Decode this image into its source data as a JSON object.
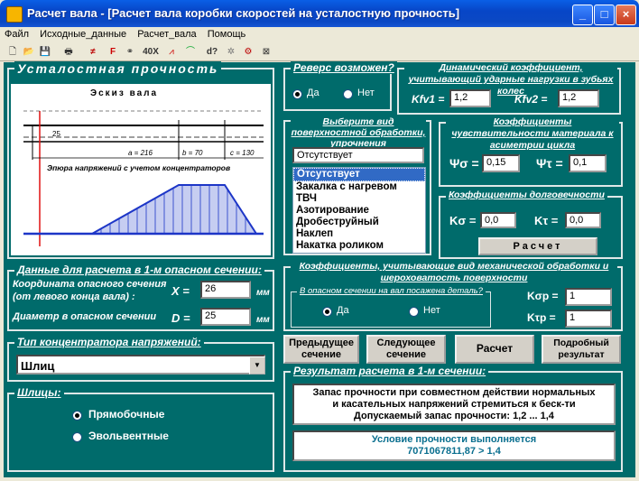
{
  "window": {
    "title": "Расчет вала - [Расчет вала коробки скоростей на усталостную прочность]"
  },
  "menu": [
    "Файл",
    "Исходные_данные",
    "Расчет_вала",
    "Помощь"
  ],
  "toolbar_icons": [
    "new-file-icon",
    "open-folder-icon",
    "save-icon",
    "print-icon",
    "formula-icon",
    "force-icon",
    "link-icon",
    "material-icon",
    "chart-icon",
    "bending-icon",
    "help-icon",
    "gear-icon",
    "settings-icon",
    "close-icon"
  ],
  "toolbar_text": {
    "material": "40Х",
    "help": "d?",
    "force": "F"
  },
  "fatigue": {
    "title": "Усталостная прочность",
    "sketch_title": "Эскиз вала",
    "dim_25": "25",
    "dim_a": "a = 216",
    "dim_b": "b = 70",
    "dim_c": "c = 130",
    "diagram_title": "Эпюра напряжений с учетом концентраторов"
  },
  "reverse": {
    "title": "Реверс возможен?",
    "yes": "Да",
    "no": "Нет",
    "selected": "Да"
  },
  "dynamic": {
    "title": "Динамический коэффициент, учитывающий ударные нагрузки в зубьях колес",
    "kfv1_label": "Kfv1 =",
    "kfv1": "1,2",
    "kfv2_label": "Kfv2 =",
    "kfv2": "1,2"
  },
  "surface": {
    "title": "Выберите вид поверхностной обработки, упрочнения",
    "current": "Отсутствует",
    "options": [
      "Отсутствует",
      "Закалка с нагревом",
      "ТВЧ",
      "Азотирование",
      "Дробеструйный",
      "Наклеп",
      "Накатка роликом"
    ],
    "selected": "Отсутствует"
  },
  "sensitivity": {
    "title": "Коэффициенты чувствительности материала к асиметрии цикла",
    "psi_sigma_label": "Ψσ =",
    "psi_sigma": "0,15",
    "psi_tau_label": "Ψτ =",
    "psi_tau": "0,1"
  },
  "durability": {
    "title": "Коэффициенты долговечности",
    "k_sigma_label": "Kσ =",
    "k_sigma": "0,0",
    "k_tau_label": "Kτ =",
    "k_tau": "0,0",
    "calc_button": "Расчет"
  },
  "section": {
    "title": "Данные для расчета в 1-м опасном сечении:",
    "coord_label_1": "Координата опасного сечения",
    "coord_label_2": "(от левого конца вала) :",
    "x_label": "X =",
    "x_value": "26",
    "x_unit": "мм",
    "diam_label": "Диаметр в опасном сечении",
    "d_label": "D =",
    "d_value": "25",
    "d_unit": "мм"
  },
  "mech": {
    "title": "Коэффициенты, учитывающие вид механической обработки и шероховатость поверхности",
    "sub_title": "В опасном сечении на вал посажена деталь?",
    "yes": "Да",
    "no": "Нет",
    "selected": "Да",
    "ksp_label": "Kσp =",
    "ksp": "1",
    "ktp_label": "Kτp =",
    "ktp": "1"
  },
  "concentrator": {
    "title": "Тип концентратора напряжений:",
    "value": "Шлиц"
  },
  "splines": {
    "title": "Шлицы:",
    "opt1": "Прямобочные",
    "opt2": "Эвольвентные",
    "selected": "Прямобочные"
  },
  "nav": {
    "prev": "Предыдущее сечение",
    "next": "Следующее сечение",
    "calc": "Расчет",
    "detail": "Подробный результат"
  },
  "result": {
    "title": "Результат расчета в 1-м сечении:",
    "text_1": "Запас прочности при совместном действии нормальных",
    "text_2": "и касательных напряжений стремиться к беск-ти",
    "text_3": "Допускаемый запас прочности: 1,2 ... 1,4",
    "status_1": "Условие прочности выполняется",
    "status_2": "7071067811,87 > 1,4"
  },
  "colors": {
    "client_bg": "#006b6b",
    "diagram_fill": "#1d36c7",
    "accent_red": "#e01010"
  }
}
